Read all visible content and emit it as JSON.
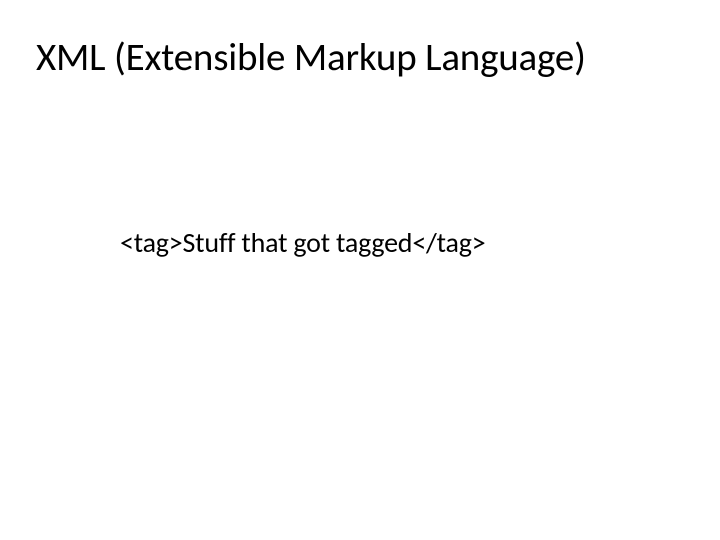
{
  "slide": {
    "title": "XML (Extensible Markup Language)",
    "body": "<tag>Stuff that got tagged</tag>"
  }
}
